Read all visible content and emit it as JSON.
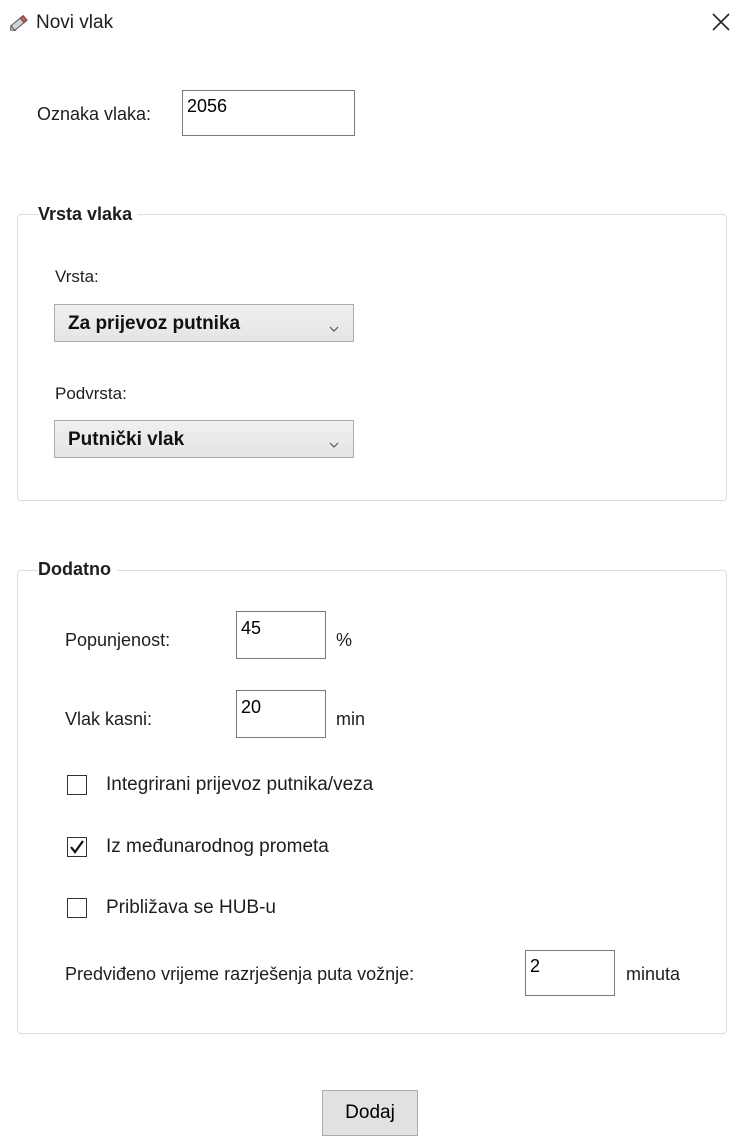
{
  "window": {
    "title": "Novi vlak",
    "icon": "pencil-icon",
    "close_icon": "close-icon"
  },
  "train_id": {
    "label": "Oznaka vlaka:",
    "value": "2056"
  },
  "train_type_group": {
    "header": "Vrsta vlaka",
    "type_label": "Vrsta:",
    "type_selected": "Za prijevoz putnika",
    "subtype_label": "Podvrsta:",
    "subtype_selected": "Putnički vlak"
  },
  "additional_group": {
    "header": "Dodatno",
    "occupancy_label": "Popunjenost:",
    "occupancy_value": "45",
    "occupancy_unit": "%",
    "delay_label": "Vlak kasni:",
    "delay_value": "20",
    "delay_unit": "min",
    "checkboxes": [
      {
        "label": "Integrirani prijevoz putnika/veza",
        "checked": false
      },
      {
        "label": "Iz međunarodnog prometa",
        "checked": true
      },
      {
        "label": "Približava se HUB-u",
        "checked": false
      }
    ],
    "resolution_label": "Predviđeno vrijeme razrješenja puta vožnje:",
    "resolution_value": "2",
    "resolution_unit": "minuta"
  },
  "actions": {
    "add_label": "Dodaj"
  }
}
